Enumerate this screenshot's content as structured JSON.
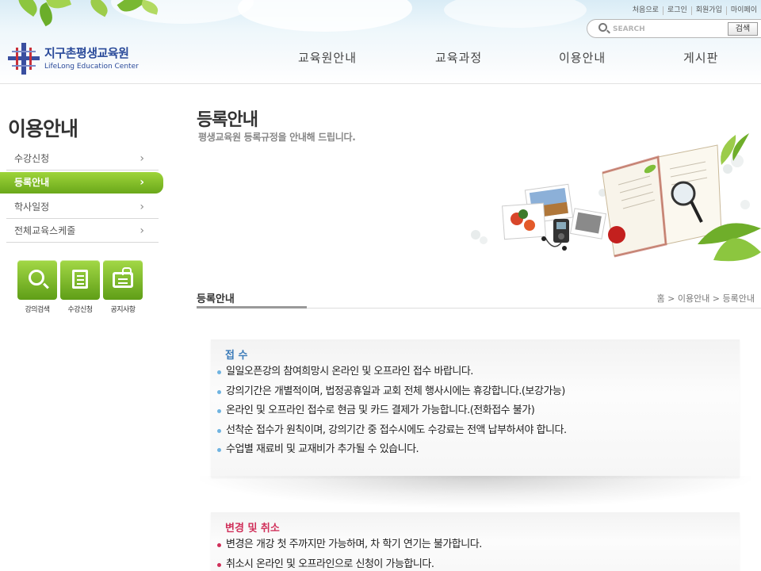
{
  "header": {
    "top_links": [
      "처음으로",
      "로그인",
      "회원가입",
      "마이페이"
    ],
    "search": {
      "placeholder": "SEARCH",
      "button_label": "검색"
    },
    "logo": {
      "title": "지구촌평생교육원",
      "subtitle": "LifeLong Education Center"
    },
    "gnb": [
      "교육원안내",
      "교육과정",
      "이용안내",
      "게시판"
    ]
  },
  "sidebar": {
    "title": "이용안내",
    "items": [
      {
        "label": "수강신청",
        "active": false
      },
      {
        "label": "등록안내",
        "active": true
      },
      {
        "label": "학사일정",
        "active": false
      },
      {
        "label": "전체교육스케줄",
        "active": false
      }
    ],
    "quick_links": [
      {
        "label": "강의검색",
        "icon": "magnifier-icon"
      },
      {
        "label": "수강신청",
        "icon": "document-icon"
      },
      {
        "label": "공지사항",
        "icon": "notice-icon"
      }
    ]
  },
  "main": {
    "title": "등록안내",
    "subtitle": "평생교육원 등록규정을 안내해 드립니다.",
    "section_title": "등록안내",
    "breadcrumb": "홈 > 이용안내 > 등록안내",
    "boxes": [
      {
        "title": "접 수",
        "color": "#3a7ab8",
        "items": [
          "일일오픈강의 참여희망시 온라인 및 오프라인 접수 바랍니다.",
          "강의기간은 개별적이며, 법정공휴일과 교회 전체 행사시에는 휴강합니다.(보강가능)",
          "온라인 및 오프라인 접수로 현금 및 카드 결제가 가능합니다.(전화접수 불가)",
          "선착순 접수가 원칙이며, 강의기간 중 접수시에도 수강료는 전액 납부하셔야 합니다.",
          "수업별 재료비 및 교재비가 추가될 수 있습니다."
        ]
      },
      {
        "title": "변경 및 취소",
        "color": "#d0305a",
        "items": [
          "변경은 개강 첫 주까지만 가능하며, 차 학기 연기는 불가합니다.",
          "취소시 온라인 및 오프라인으로 신청이 가능합니다."
        ]
      }
    ]
  },
  "colors": {
    "accent_green": "#7ab72a",
    "box1_title": "#3a7ab8",
    "box2_title": "#d0305a"
  }
}
